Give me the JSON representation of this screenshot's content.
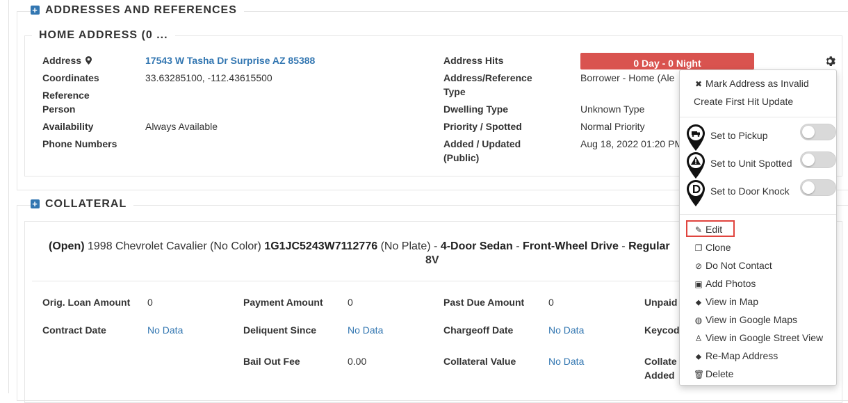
{
  "addresses_section": {
    "title": "ADDRESSES AND REFERENCES",
    "home_address": {
      "title": "HOME ADDRESS (0 ...",
      "left_fields": [
        {
          "label": "Address",
          "value": "17543 W Tasha Dr Surprise AZ 85388"
        },
        {
          "label": "Coordinates",
          "value": "33.63285100, -112.43615500"
        },
        {
          "label": "Reference Person",
          "value": ""
        },
        {
          "label": "Availability",
          "value": "Always Available"
        },
        {
          "label": "Phone Numbers",
          "value": ""
        }
      ],
      "right_fields": [
        {
          "label": "Address Hits",
          "value": "0 Day - 0 Night"
        },
        {
          "label": "Address/Reference Type",
          "value": "Borrower - Home (Ale"
        },
        {
          "label": "Dwelling Type",
          "value": "Unknown Type"
        },
        {
          "label": "Priority / Spotted",
          "value": "Normal Priority"
        },
        {
          "label": "Added / Updated (Public)",
          "value": "Aug 18, 2022 01:20 PM"
        }
      ]
    }
  },
  "collateral_section": {
    "title": "COLLATERAL",
    "vehicle": {
      "status": "(Open)",
      "description": " 1998 Chevrolet Cavalier (No Color) ",
      "vin": "1G1JC5243W7112776",
      "plate": " (No Plate) - ",
      "body": "4-Door Sedan",
      "sep1": " - ",
      "drive": "Front-Wheel Drive",
      "sep2": " - ",
      "engine": "Regular",
      "engine_line2": "8V"
    },
    "fields": [
      {
        "label": "Orig. Loan Amount",
        "value": "0"
      },
      {
        "label": "Payment Amount",
        "value": "0"
      },
      {
        "label": "Past Due Amount",
        "value": "0"
      },
      {
        "label": "Unpaid",
        "value": ""
      },
      {
        "label": "Contract Date",
        "value": "No Data"
      },
      {
        "label": "Deliquent Since",
        "value": "No Data"
      },
      {
        "label": "Chargeoff Date",
        "value": "No Data"
      },
      {
        "label": "Keycod",
        "value": ""
      },
      {
        "label": "Bail Out Fee",
        "value": "0.00"
      },
      {
        "label": "Collateral Value",
        "value": "No Data"
      },
      {
        "label": "Collate Added",
        "value": ""
      }
    ]
  },
  "context_menu": {
    "top_items": [
      {
        "label": "Mark Address as Invalid",
        "icon": "times-icon"
      },
      {
        "label": "Create First Hit Update",
        "icon": ""
      }
    ],
    "toggles": [
      {
        "label": "Set to Pickup",
        "icon": "truck-pin-icon",
        "on": false
      },
      {
        "label": "Set to Unit Spotted",
        "icon": "warning-pin-icon",
        "on": false
      },
      {
        "label": "Set to Door Knock",
        "icon": "door-pin-icon",
        "on": false
      }
    ],
    "bottom_items": [
      {
        "label": "Edit",
        "icon": "edit-icon"
      },
      {
        "label": "Clone",
        "icon": "clone-icon"
      },
      {
        "label": "Do Not Contact",
        "icon": "ban-icon"
      },
      {
        "label": "Add Photos",
        "icon": "photo-icon"
      },
      {
        "label": "View in Map",
        "icon": "map-marker-icon"
      },
      {
        "label": "View in Google Maps",
        "icon": "globe-icon"
      },
      {
        "label": "View in Google Street View",
        "icon": "street-view-icon"
      },
      {
        "label": "Re-Map Address",
        "icon": "map-marker-icon"
      },
      {
        "label": "Delete",
        "icon": "trash-icon"
      }
    ]
  },
  "colors": {
    "accent": "#3276b1",
    "danger": "#d9534f",
    "highlight": "#e0443e"
  }
}
